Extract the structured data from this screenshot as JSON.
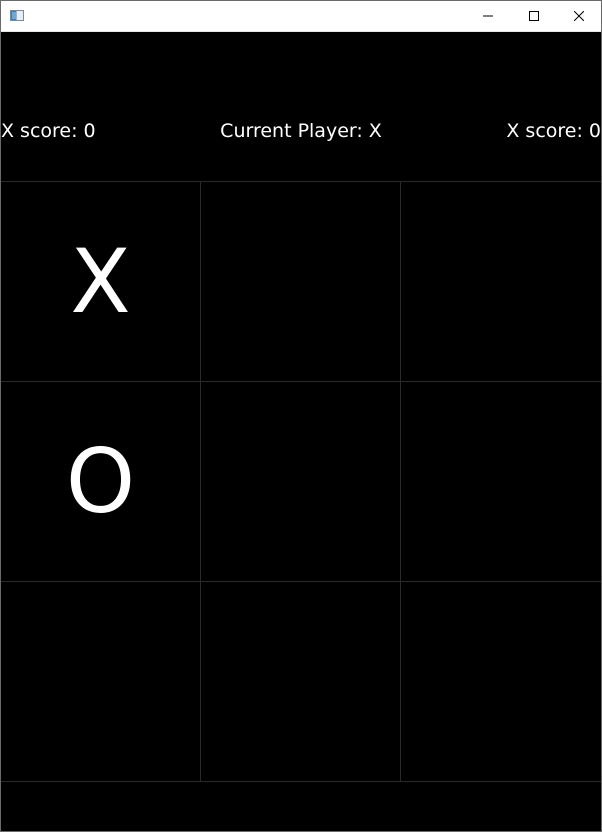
{
  "window": {
    "title": "",
    "icons": {
      "app": "app-window-icon",
      "minimize": "minimize-icon",
      "maximize": "maximize-icon",
      "close": "close-icon"
    }
  },
  "status": {
    "left_score": "X score: 0",
    "current_player": "Current Player: X",
    "right_score": "X score: 0"
  },
  "board": {
    "cells": [
      "X",
      "",
      "",
      "O",
      "",
      "",
      "",
      "",
      ""
    ]
  },
  "colors": {
    "background": "#000000",
    "text": "#ffffff",
    "grid_lines": "#2a2a2a",
    "titlebar": "#ffffff"
  }
}
